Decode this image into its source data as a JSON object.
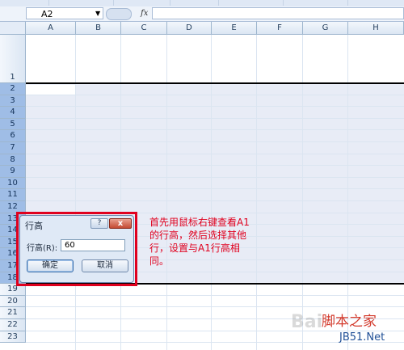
{
  "formula_bar": {
    "name_box": "A2",
    "fx_symbol": "fx",
    "formula_value": ""
  },
  "columns": [
    "A",
    "B",
    "C",
    "D",
    "E",
    "F",
    "G",
    "H"
  ],
  "rows": [
    "1",
    "2",
    "3",
    "4",
    "5",
    "6",
    "7",
    "8",
    "9",
    "10",
    "11",
    "12",
    "13",
    "14",
    "15",
    "16",
    "17",
    "18",
    "19",
    "20",
    "21",
    "22",
    "23"
  ],
  "selected_rows": [
    "2",
    "3",
    "4",
    "5",
    "6",
    "7",
    "8",
    "9",
    "10",
    "11",
    "12",
    "13",
    "14",
    "15",
    "16",
    "17",
    "18"
  ],
  "dialog": {
    "title": "行高",
    "help_icon": "?",
    "close_icon": "x",
    "field_label": "行高(R):",
    "field_value": "60",
    "ok_label": "确定",
    "cancel_label": "取消"
  },
  "annotation": "首先用鼠标右键查看A1的行高，然后选择其他行，设置与A1行高相同。",
  "watermark": {
    "logo": "脚本之家",
    "site": "JB51.Net",
    "bg": "Bai"
  },
  "colors": {
    "annotation": "#e0001e",
    "selection": "#e8ecf6",
    "header": "#dbe6f3"
  }
}
